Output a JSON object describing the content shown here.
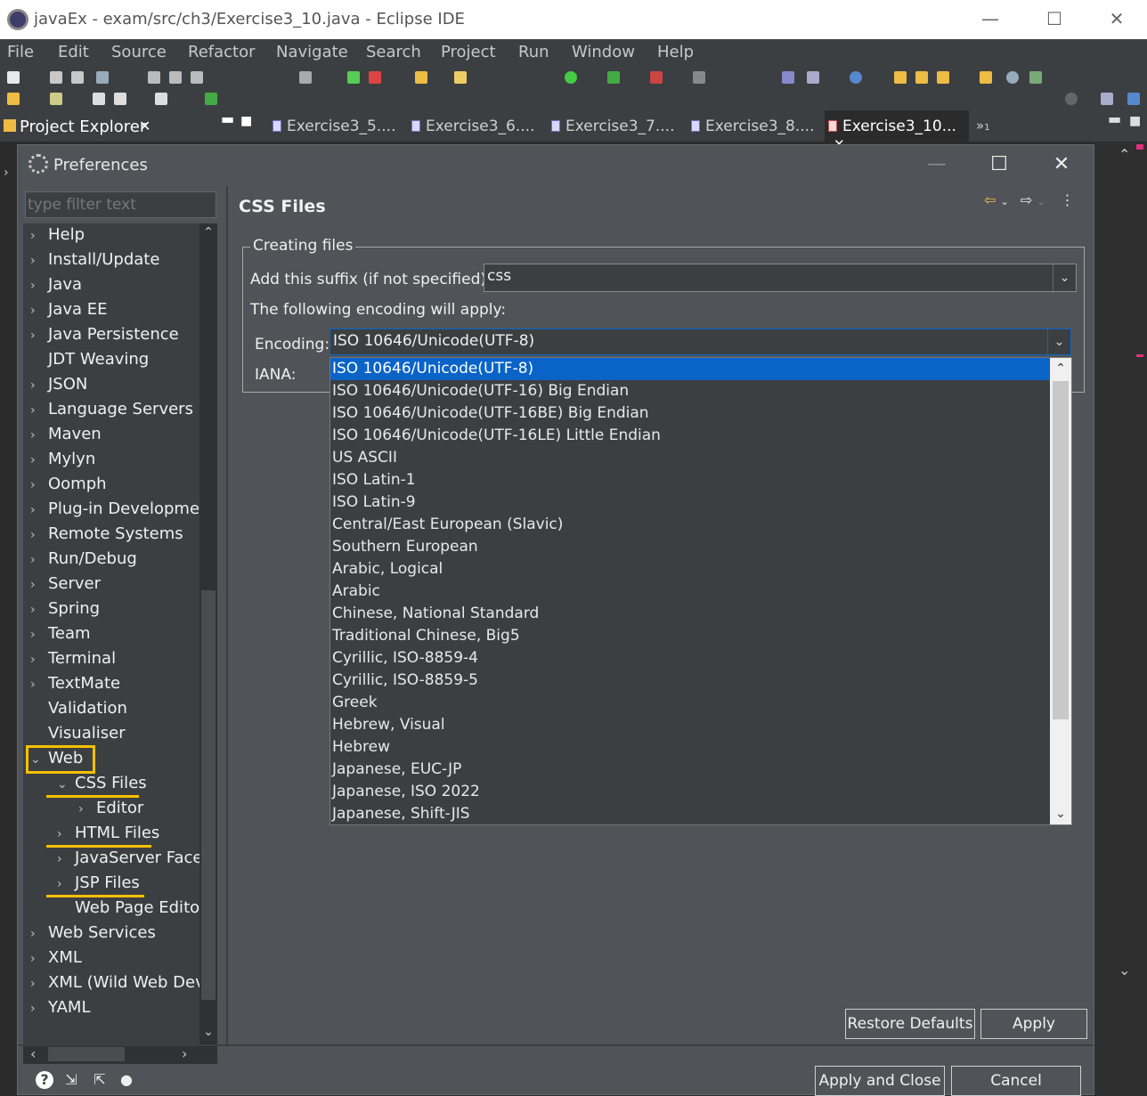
{
  "window": {
    "title": "javaEx - exam/src/ch3/Exercise3_10.java - Eclipse IDE",
    "minimize": "—",
    "maximize": "☐",
    "close": "✕"
  },
  "menu": [
    "File",
    "Edit",
    "Source",
    "Refactor",
    "Navigate",
    "Search",
    "Project",
    "Run",
    "Window",
    "Help"
  ],
  "project_explorer": {
    "label": "Project Explorer",
    "close": "✕"
  },
  "editor_tabs": [
    {
      "label": "Exercise3_5...."
    },
    {
      "label": "Exercise3_6...."
    },
    {
      "label": "Exercise3_7...."
    },
    {
      "label": "Exercise3_8...."
    },
    {
      "label": "Exercise3_10...",
      "close": "✕"
    }
  ],
  "tab_overflow": "»",
  "tab_overflow_count": "1",
  "dialog": {
    "title": "Preferences",
    "filter_placeholder": "type filter text",
    "page_title": "CSS Files",
    "group_label": "Creating files",
    "suffix_label": "Add this suffix (if not specified):",
    "suffix_value": "css",
    "encoding_note": "The following encoding will apply:",
    "encoding_label": "Encoding:",
    "encoding_value": "ISO 10646/Unicode(UTF-8)",
    "iana_label": "IANA:",
    "restore_defaults": "Restore Defaults",
    "apply": "Apply",
    "apply_close": "Apply and Close",
    "cancel": "Cancel"
  },
  "tree": [
    {
      "label": "Help",
      "arrow": "›"
    },
    {
      "label": "Install/Update",
      "arrow": "›"
    },
    {
      "label": "Java",
      "arrow": "›"
    },
    {
      "label": "Java EE",
      "arrow": "›"
    },
    {
      "label": "Java Persistence",
      "arrow": "›"
    },
    {
      "label": "JDT Weaving",
      "arrow": ""
    },
    {
      "label": "JSON",
      "arrow": "›"
    },
    {
      "label": "Language Servers",
      "arrow": "›"
    },
    {
      "label": "Maven",
      "arrow": "›"
    },
    {
      "label": "Mylyn",
      "arrow": "›"
    },
    {
      "label": "Oomph",
      "arrow": "›"
    },
    {
      "label": "Plug-in Developmer",
      "arrow": "›"
    },
    {
      "label": "Remote Systems",
      "arrow": "›"
    },
    {
      "label": "Run/Debug",
      "arrow": "›"
    },
    {
      "label": "Server",
      "arrow": "›"
    },
    {
      "label": "Spring",
      "arrow": "›"
    },
    {
      "label": "Team",
      "arrow": "›"
    },
    {
      "label": "Terminal",
      "arrow": "›"
    },
    {
      "label": "TextMate",
      "arrow": "›"
    },
    {
      "label": "Validation",
      "arrow": ""
    },
    {
      "label": "Visualiser",
      "arrow": ""
    },
    {
      "label": "Web",
      "arrow": "⌄"
    },
    {
      "label": "CSS Files",
      "arrow": "⌄"
    },
    {
      "label": "Editor",
      "arrow": "›"
    },
    {
      "label": "HTML Files",
      "arrow": "›"
    },
    {
      "label": "JavaServer Faces",
      "arrow": "›"
    },
    {
      "label": "JSP Files",
      "arrow": "›"
    },
    {
      "label": "Web Page Editor",
      "arrow": ""
    },
    {
      "label": "Web Services",
      "arrow": "›"
    },
    {
      "label": "XML",
      "arrow": "›"
    },
    {
      "label": "XML (Wild Web Dev",
      "arrow": "›"
    },
    {
      "label": "YAML",
      "arrow": "›"
    }
  ],
  "encodings": [
    "ISO 10646/Unicode(UTF-8)",
    "ISO 10646/Unicode(UTF-16) Big Endian",
    "ISO 10646/Unicode(UTF-16BE) Big Endian",
    "ISO 10646/Unicode(UTF-16LE) Little Endian",
    "US ASCII",
    "ISO Latin-1",
    "ISO Latin-9",
    "Central/East European (Slavic)",
    "Southern European",
    "Arabic, Logical",
    "Arabic",
    "Chinese, National Standard",
    "Traditional Chinese, Big5",
    "Cyrillic, ISO-8859-4",
    "Cyrillic, ISO-8859-5",
    "Greek",
    "Hebrew, Visual",
    "Hebrew",
    "Japanese, EUC-JP",
    "Japanese, ISO 2022",
    "Japanese, Shift-JIS"
  ],
  "icons": {
    "chevron_up": "⌃",
    "chevron_down": "⌄",
    "chevron_left": "‹",
    "chevron_right": "›",
    "back_arrow": "⇦",
    "forward_arrow": "⇨",
    "more": "⋮",
    "help": "?",
    "import": "⇲",
    "export": "⇱",
    "record": "●"
  },
  "colors": {
    "highlight": "#f8c000",
    "selection": "#0a64c8"
  }
}
